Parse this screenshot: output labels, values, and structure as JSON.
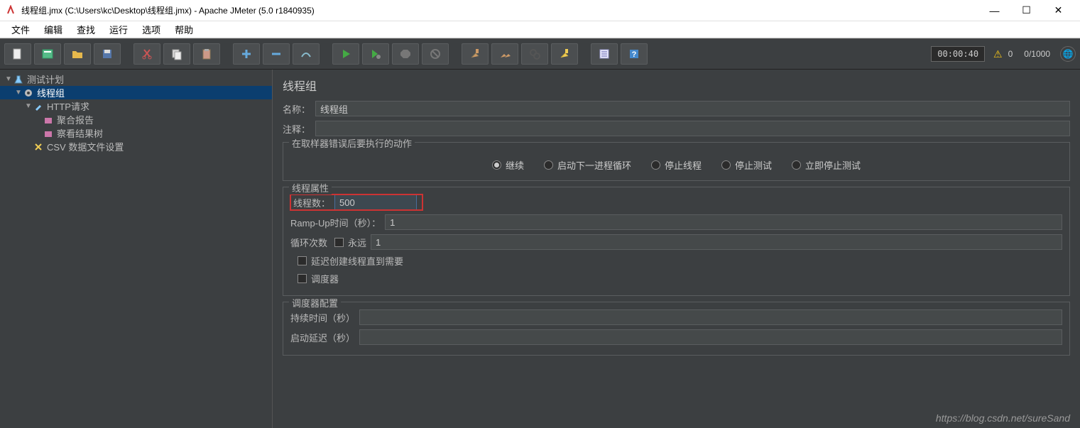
{
  "window": {
    "title": "线程组.jmx (C:\\Users\\kc\\Desktop\\线程组.jmx) - Apache JMeter (5.0 r1840935)"
  },
  "menu": [
    "文件",
    "编辑",
    "查找",
    "运行",
    "选项",
    "帮助"
  ],
  "toolbar": {
    "elapsed": "00:00:40",
    "warn_count": "0",
    "thread_count": "0/1000"
  },
  "tree": {
    "root": "测试计划",
    "thread_group": "线程组",
    "http_request": "HTTP请求",
    "aggregate_report": "聚合报告",
    "view_results_tree": "察看结果树",
    "csv_config": "CSV 数据文件设置"
  },
  "panel": {
    "title": "线程组",
    "name_label": "名称：",
    "name_value": "线程组",
    "comment_label": "注释：",
    "comment_value": "",
    "error_action": {
      "legend": "在取样器错误后要执行的动作",
      "options": [
        "继续",
        "启动下一进程循环",
        "停止线程",
        "停止测试",
        "立即停止测试"
      ],
      "selected": 0
    },
    "thread_props": {
      "legend": "线程属性",
      "threads_label": "线程数：",
      "threads_value": "500",
      "rampup_label": "Ramp-Up时间（秒）：",
      "rampup_value": "1",
      "loop_label": "循环次数",
      "forever_label": "永远",
      "loop_value": "1",
      "delay_create_label": "延迟创建线程直到需要",
      "scheduler_label": "调度器"
    },
    "scheduler": {
      "legend": "调度器配置",
      "duration_label": "持续时间（秒）",
      "duration_value": "",
      "delay_label": "启动延迟（秒）",
      "delay_value": ""
    }
  },
  "watermark": "https://blog.csdn.net/sureSand"
}
